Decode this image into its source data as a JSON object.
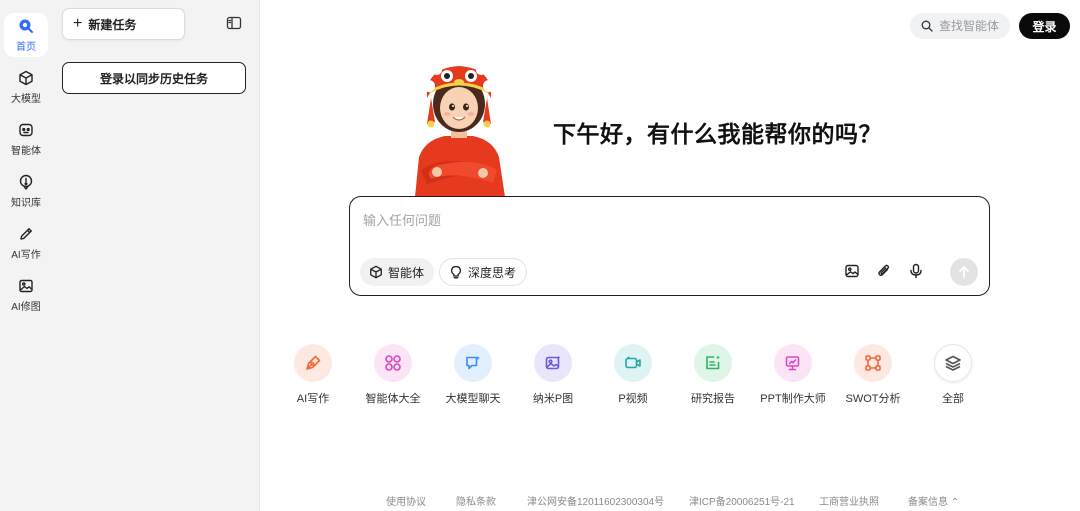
{
  "rail": {
    "items": [
      {
        "label": "首页",
        "icon": "home-icon",
        "active": true
      },
      {
        "label": "大模型",
        "icon": "cube-icon"
      },
      {
        "label": "智能体",
        "icon": "robot-icon"
      },
      {
        "label": "知识库",
        "icon": "knowledge-icon"
      },
      {
        "label": "AI写作",
        "icon": "pencil-icon"
      },
      {
        "label": "AI修图",
        "icon": "image-icon"
      }
    ]
  },
  "panel": {
    "new_task_label": "新建任务",
    "login_sync_label": "登录以同步历史任务"
  },
  "header": {
    "search_placeholder": "查找智能体",
    "login_label": "登录"
  },
  "main": {
    "greeting": "下午好，有什么我能帮你的吗？",
    "input_placeholder": "输入任何问题",
    "chip_agent": "智能体",
    "chip_deep": "深度思考"
  },
  "shortcuts": [
    {
      "label": "AI写作",
      "icon": "pen-nib-icon",
      "bg": "#fde9e2",
      "color": "#ee6a3c"
    },
    {
      "label": "智能体大全",
      "icon": "apps-grid-icon",
      "bg": "#fbe4f6",
      "color": "#d946c6"
    },
    {
      "label": "大模型聊天",
      "icon": "chat-bubble-icon",
      "bg": "#e2f0fd",
      "color": "#3b8ff0"
    },
    {
      "label": "纳米P图",
      "icon": "photo-edit-icon",
      "bg": "#e9e6fb",
      "color": "#6a5ae0"
    },
    {
      "label": "P视频",
      "icon": "video-icon",
      "bg": "#def3f3",
      "color": "#25a7a7"
    },
    {
      "label": "研究报告",
      "icon": "report-icon",
      "bg": "#dff5e8",
      "color": "#2db36b"
    },
    {
      "label": "PPT制作大师",
      "icon": "presentation-icon",
      "bg": "#fbe4f6",
      "color": "#d946c6"
    },
    {
      "label": "SWOT分析",
      "icon": "swot-icon",
      "bg": "#fde9e2",
      "color": "#ee6a3c"
    },
    {
      "label": "全部",
      "icon": "layers-icon",
      "bg": "#ffffff",
      "color": "#555555"
    }
  ],
  "footer": {
    "links": [
      "使用协议",
      "隐私条款",
      "津公网安备12011602300304号",
      "津ICP备20006251号-21",
      "工商营业执照",
      "备案信息 ⌃"
    ]
  },
  "colors": {
    "accent": "#2f6bff",
    "mascot_red": "#e63a1f"
  }
}
